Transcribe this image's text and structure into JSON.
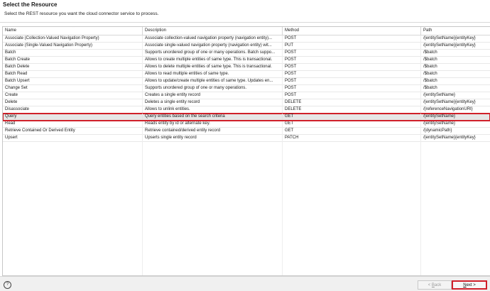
{
  "header": {
    "title": "Select the Resource",
    "subtitle": "Select the REST resource you want the cloud connector service to process."
  },
  "table": {
    "columns": [
      "Name",
      "Description",
      "Method",
      "Path"
    ],
    "rows": [
      {
        "name": "Associate (Collection-Valued Navigation Property)",
        "description": "Associate collection-valued navigation property (navigation entity)...",
        "method": "POST",
        "path": "/{entitySetName}{entityKey}"
      },
      {
        "name": "Associate (Single-Valued Navigation Property)",
        "description": "Associate single-valued navigation property (navigation entity) wit...",
        "method": "PUT",
        "path": "/{entitySetName}{entityKey}"
      },
      {
        "name": "Batch",
        "description": "Supports unordered group of one or many operations. Batch suppo...",
        "method": "POST",
        "path": "/$batch"
      },
      {
        "name": "Batch Create",
        "description": "Allows to create multiple entities of same type. This is transactional.",
        "method": "POST",
        "path": "/$batch"
      },
      {
        "name": "Batch Delete",
        "description": "Allows to delete multiple entities of same type. This is transactional.",
        "method": "POST",
        "path": "/$batch"
      },
      {
        "name": "Batch Read",
        "description": "Allows to read multiple entities of same type.",
        "method": "POST",
        "path": "/$batch"
      },
      {
        "name": "Batch Upsert",
        "description": "Allows to update/create multiple entities of same type. Updates en...",
        "method": "POST",
        "path": "/$batch"
      },
      {
        "name": "Change Set",
        "description": "Supports unordered group of one or many operations.",
        "method": "POST",
        "path": "/$batch"
      },
      {
        "name": "Create",
        "description": "Creates a single entity record",
        "method": "POST",
        "path": "/{entitySetName}"
      },
      {
        "name": "Delete",
        "description": "Deletes a single entity record",
        "method": "DELETE",
        "path": "/{entitySetName}{entityKey}"
      },
      {
        "name": "Disassociate",
        "description": "Allows to unlink entities.",
        "method": "DELETE",
        "path": "/{referenceNavigationURI}"
      },
      {
        "name": "Query",
        "description": "Query entities based on the search criteria",
        "method": "GET",
        "path": "/{entitySetName}"
      },
      {
        "name": "Read",
        "description": "Reads entity by id or alternate key.",
        "method": "GET",
        "path": "/{entitySetName}"
      },
      {
        "name": "Retrieve Contained Or Derived Entity",
        "description": "Retrieve contained/derived entity record",
        "method": "GET",
        "path": "/{dynamicPath}"
      },
      {
        "name": "Upsert",
        "description": "Upserts single entity record",
        "method": "PATCH",
        "path": "/{entitySetName}{entityKey}"
      }
    ],
    "selected_index": 11
  },
  "footer": {
    "help_icon": "help-icon",
    "help_glyph": "?",
    "back_label": "< Back",
    "back_mnemonic": "B",
    "next_label": "Next >",
    "next_mnemonic": "N"
  },
  "colors": {
    "highlight_border": "#d0202a",
    "selected_row_bg": "#e6e6e6"
  }
}
